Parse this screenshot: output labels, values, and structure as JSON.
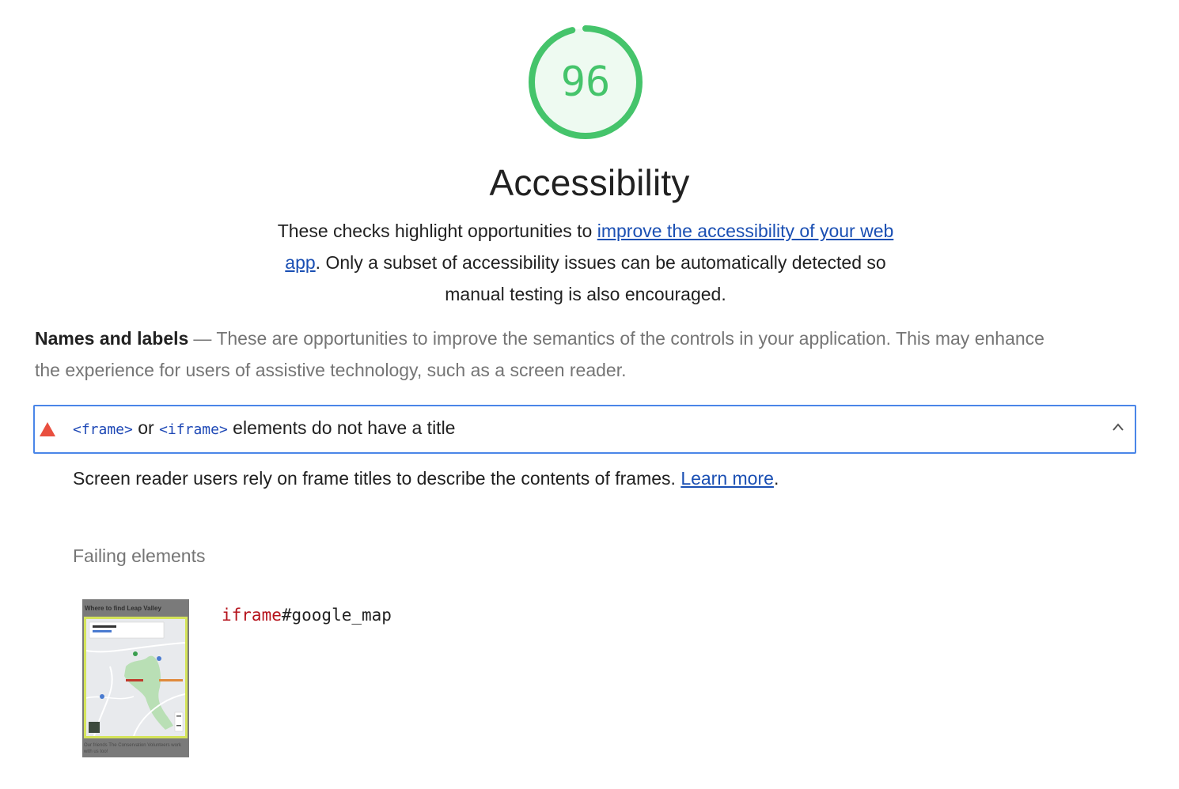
{
  "gauge": {
    "score": "96",
    "score_fraction": 0.96,
    "color": "#45c46b",
    "fill_color": "#eefaf1"
  },
  "category": {
    "title": "Accessibility",
    "description_before": "These checks highlight opportunities to ",
    "description_link": "improve the accessibility of your web app",
    "description_after": ". Only a subset of accessibility issues can be automatically detected so manual testing is also encouraged."
  },
  "group": {
    "title": "Names and labels",
    "separator": "—",
    "description": "These are opportunities to improve the semantics of the controls in your application. This may enhance the experience for users of assistive technology, such as a screen reader."
  },
  "audit": {
    "status_icon": "fail-triangle-icon",
    "status_color": "#e94f3f",
    "title_code_1": "<frame>",
    "title_or": " or ",
    "title_code_2": "<iframe>",
    "title_rest": " elements do not have a title",
    "expanded": true,
    "toggle_icon": "chevron-up-icon",
    "description": "Screen reader users rely on frame titles to describe the contents of frames. ",
    "learn_more": "Learn more",
    "description_end": "."
  },
  "failing": {
    "label": "Failing elements",
    "items": [
      {
        "thumbnail_caption": "Where to find Leap Valley",
        "thumbnail_footer": "Our friends The Conservation Volunteers work with us too!",
        "selector_tag": "iframe",
        "selector_rest": "#google_map"
      }
    ]
  }
}
